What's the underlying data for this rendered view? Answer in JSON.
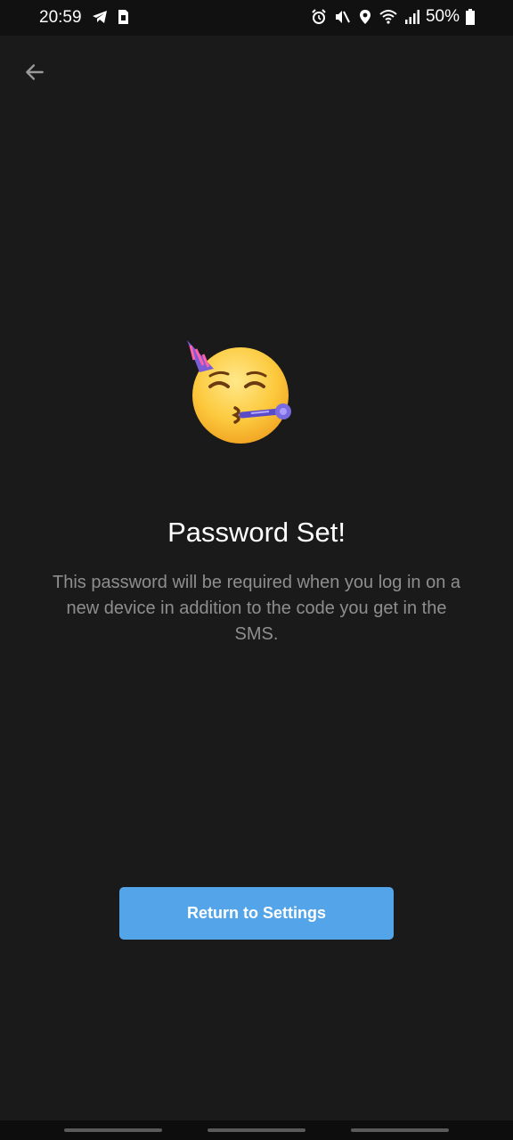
{
  "status_bar": {
    "time": "20:59",
    "battery": "50%",
    "left_icons": [
      "telegram-icon",
      "sim-icon"
    ],
    "right_icons": [
      "alarm-icon",
      "mute-icon",
      "location-icon",
      "wifi-icon",
      "signal-icon",
      "battery-icon"
    ]
  },
  "header": {
    "back_icon": "arrow-left-icon"
  },
  "main": {
    "emoji": "partying-face-emoji",
    "title": "Password Set!",
    "description": "This password will be required when you log in on a new device in addition to the code you get in the SMS."
  },
  "actions": {
    "return_label": "Return to Settings"
  },
  "colors": {
    "background": "#1a1a1a",
    "accent": "#53a4e8",
    "secondary_text": "#8e8e8e"
  }
}
